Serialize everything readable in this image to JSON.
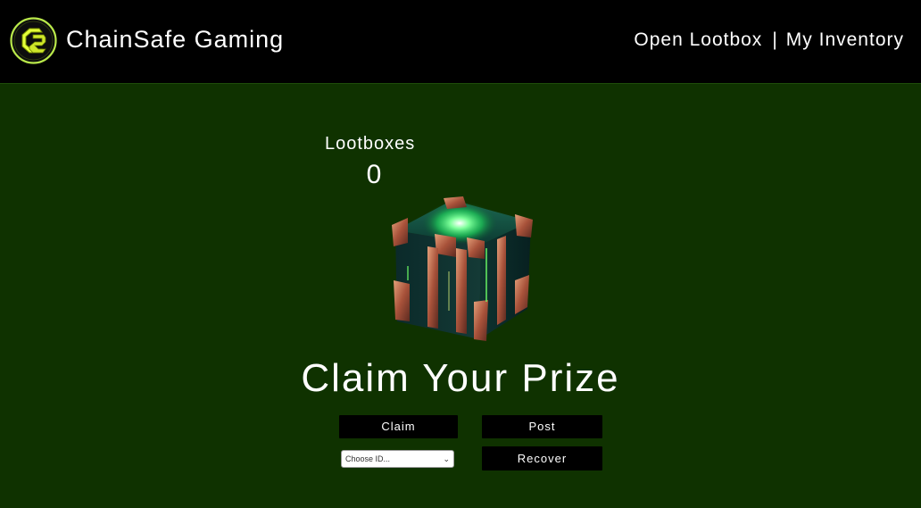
{
  "header": {
    "brand": "ChainSafe Gaming",
    "nav_open_lootbox": "Open Lootbox",
    "nav_separator": "|",
    "nav_inventory": "My Inventory"
  },
  "lootbox": {
    "label": "Lootboxes",
    "count": "0"
  },
  "claim": {
    "title": "Claim Your Prize",
    "claim_label": "Claim",
    "post_label": "Post",
    "recover_label": "Recover",
    "select_value": "Choose ID..."
  },
  "colors": {
    "header_bg": "#000000",
    "main_bg": "#0f3200",
    "logo_accent": "#c8f03a",
    "button_bg": "#000000",
    "text": "#ffffff"
  }
}
